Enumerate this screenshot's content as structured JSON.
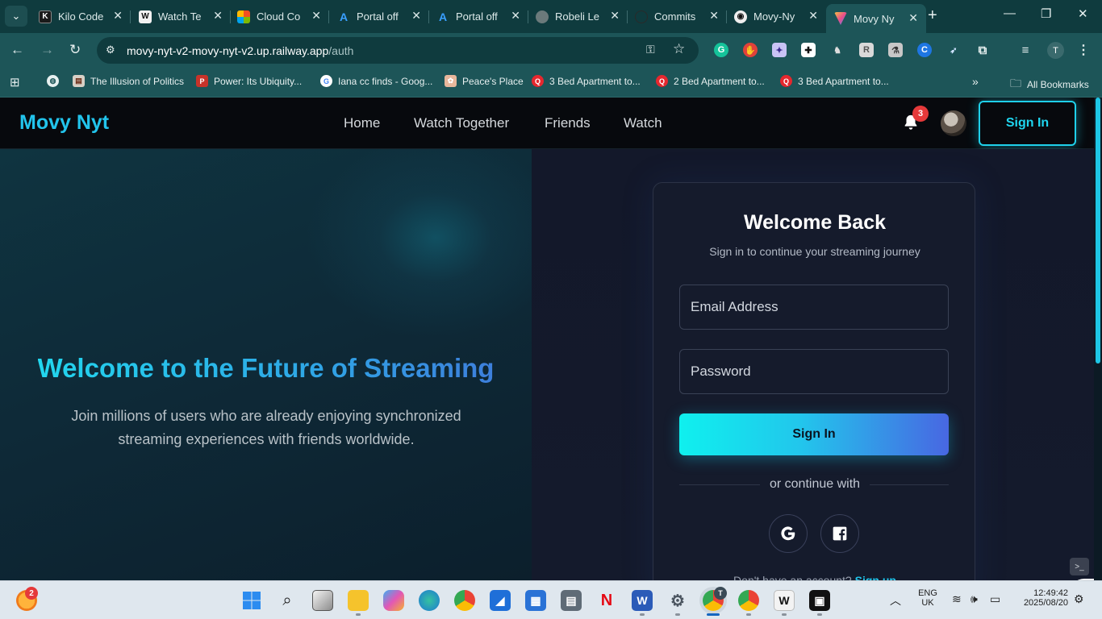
{
  "browser": {
    "tabs": [
      {
        "title": "Kilo Code",
        "favicon": "kilo-code-favicon"
      },
      {
        "title": "Watch Te",
        "favicon": "watch-favicon"
      },
      {
        "title": "Cloud Co",
        "favicon": "microsoft-favicon"
      },
      {
        "title": "Portal off",
        "favicon": "azure-favicon"
      },
      {
        "title": "Portal off",
        "favicon": "azure-favicon"
      },
      {
        "title": "Robeli Le",
        "favicon": "robeli-favicon"
      },
      {
        "title": "Commits",
        "favicon": "github-favicon"
      },
      {
        "title": "Movy-Ny",
        "favicon": "movy-favicon"
      },
      {
        "title": "Movy Ny",
        "favicon": "movy-favicon",
        "active": true
      }
    ],
    "new_tab": "+",
    "address": {
      "host": "movy-nyt-v2-movy-nyt-v2.up.railway.app",
      "path": "/auth"
    },
    "profile_initial": "T",
    "bookmarks": [
      {
        "label": "The Illusion of Politics"
      },
      {
        "label": "Power: Its Ubiquity..."
      },
      {
        "label": "Iana cc finds - Goog..."
      },
      {
        "label": "Peace's Place"
      },
      {
        "label": "3 Bed Apartment to..."
      },
      {
        "label": "2 Bed Apartment to..."
      },
      {
        "label": "3 Bed Apartment to..."
      }
    ],
    "overflow": "»",
    "all_bookmarks": "All Bookmarks"
  },
  "site": {
    "brand": "Movy Nyt",
    "nav": [
      "Home",
      "Watch Together",
      "Friends",
      "Watch"
    ],
    "notification_count": "3",
    "signin_label": "Sign In"
  },
  "hero": {
    "title": "Welcome to the Future of Streaming",
    "subtitle": "Join millions of users who are already enjoying synchronized streaming experiences with friends worldwide."
  },
  "auth": {
    "title": "Welcome Back",
    "subtitle": "Sign in to continue your streaming journey",
    "email_placeholder": "Email Address",
    "password_placeholder": "Password",
    "submit_label": "Sign In",
    "divider": "or continue with",
    "footer_prefix": "Don't have an account?",
    "footer_link": "Sign up"
  },
  "taskbar": {
    "weather_badge": "2",
    "chrome_badge": "T",
    "language": "ENG",
    "region": "UK",
    "time": "12:49:42",
    "date": "2025/08/20"
  },
  "colors": {
    "brand": "#22c4ec",
    "accent_gradient_start": "#0ff0ee",
    "accent_gradient_end": "#4867e2",
    "badge": "#e5393a"
  }
}
